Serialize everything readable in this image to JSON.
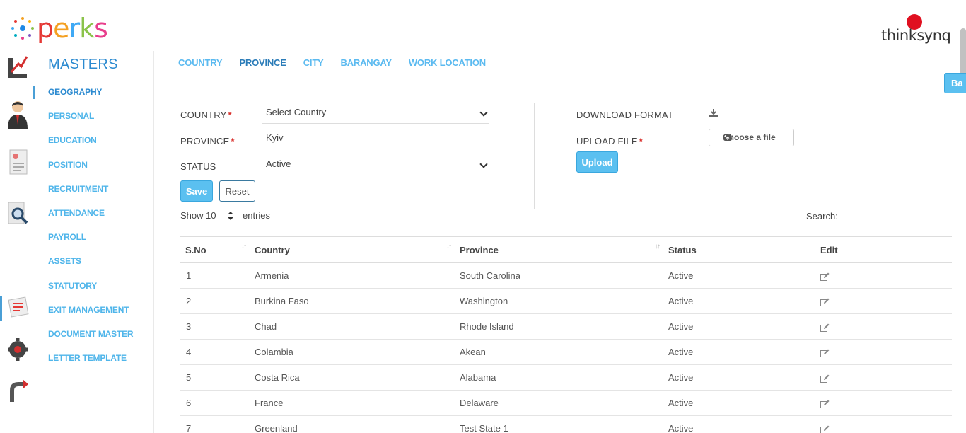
{
  "app": {
    "logo_text": "perks",
    "brand": "thinksynq"
  },
  "sidebar": {
    "title": "MASTERS",
    "items": [
      "GEOGRAPHY",
      "PERSONAL",
      "EDUCATION",
      "POSITION",
      "RECRUITMENT",
      "ATTENDANCE",
      "PAYROLL",
      "ASSETS",
      "STATUTORY",
      "EXIT MANAGEMENT",
      "DOCUMENT MASTER",
      "LETTER TEMPLATE"
    ]
  },
  "tabs": [
    "COUNTRY",
    "PROVINCE",
    "CITY",
    "BARANGAY",
    "WORK LOCATION"
  ],
  "back_label": "Ba",
  "form": {
    "country_label": "COUNTRY",
    "country_value": "Select Country",
    "province_label": "PROVINCE",
    "province_value": "Kyiv",
    "status_label": "STATUS",
    "status_value": "Active",
    "save_label": "Save",
    "reset_label": "Reset",
    "required_mark": "*"
  },
  "upload": {
    "download_label": "DOWNLOAD FORMAT",
    "upload_label": "UPLOAD FILE",
    "choose_label": "Choose a file",
    "upload_button": "Upload"
  },
  "table_controls": {
    "show_label": "Show",
    "page_size": "10",
    "entries_label": "entries",
    "search_label": "Search:"
  },
  "table": {
    "columns": [
      "S.No",
      "Country",
      "Province",
      "Status",
      "Edit"
    ],
    "rows": [
      [
        "1",
        "Armenia",
        "South Carolina",
        "Active"
      ],
      [
        "2",
        "Burkina Faso",
        "Washington",
        "Active"
      ],
      [
        "3",
        "Chad",
        "Rhode Island",
        "Active"
      ],
      [
        "4",
        "Colambia",
        "Akean",
        "Active"
      ],
      [
        "5",
        "Costa Rica",
        "Alabama",
        "Active"
      ],
      [
        "6",
        "France",
        "Delaware",
        "Active"
      ],
      [
        "7",
        "Greenland",
        "Test State 1",
        "Active"
      ]
    ]
  },
  "colors": {
    "accent": "#5bc0f0",
    "menu_text": "#4fb5ea",
    "title_blue": "#2b8ad0",
    "required": "#d9302c",
    "brand_red": "#e01020"
  }
}
